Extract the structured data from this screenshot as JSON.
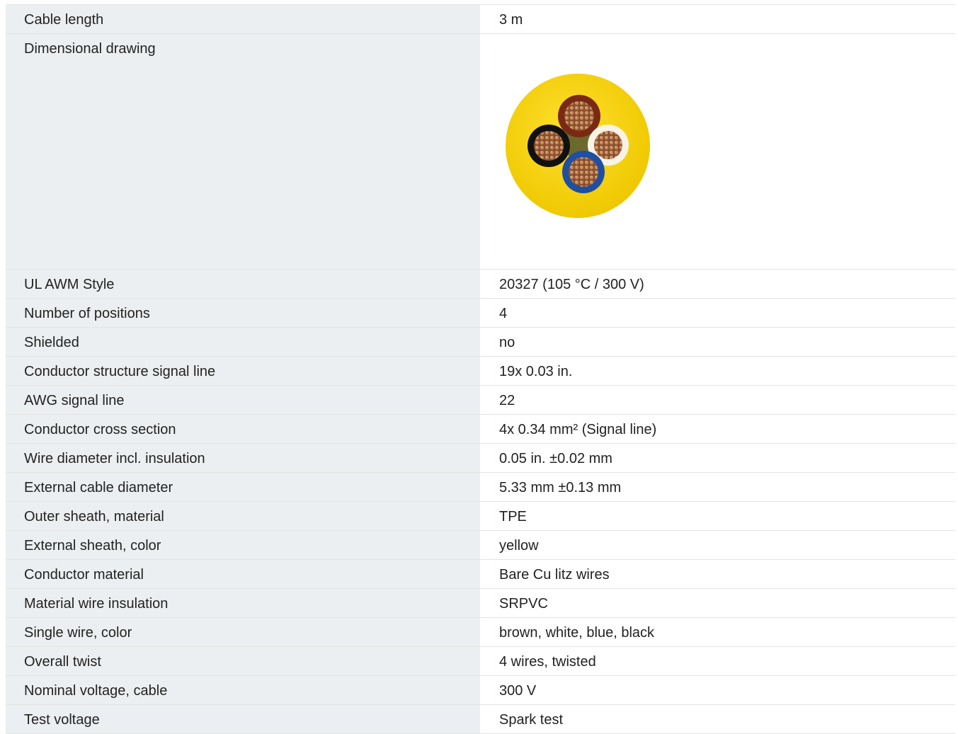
{
  "specs": [
    {
      "label": "Cable length",
      "value": "3 m"
    },
    {
      "label": "Dimensional drawing",
      "image": "cable-cross-section-drawing"
    },
    {
      "label": "UL AWM Style",
      "value": "20327 (105 °C / 300 V)"
    },
    {
      "label": "Number of positions",
      "value": "4"
    },
    {
      "label": "Shielded",
      "value": "no"
    },
    {
      "label": "Conductor structure signal line",
      "value": "19x 0.03 in."
    },
    {
      "label": "AWG signal line",
      "value": "22"
    },
    {
      "label": "Conductor cross section",
      "value": "4x 0.34 mm² (Signal line)"
    },
    {
      "label": "Wire diameter incl. insulation",
      "value": "0.05 in. ±0.02 mm"
    },
    {
      "label": "External cable diameter",
      "value": "5.33 mm ±0.13 mm"
    },
    {
      "label": "Outer sheath, material",
      "value": "TPE"
    },
    {
      "label": "External sheath, color",
      "value": "yellow"
    },
    {
      "label": "Conductor material",
      "value": "Bare Cu litz wires"
    },
    {
      "label": "Material wire insulation",
      "value": "SRPVC"
    },
    {
      "label": "Single wire, color",
      "value": "brown, white, blue, black"
    },
    {
      "label": "Overall twist",
      "value": "4 wires, twisted"
    },
    {
      "label": "Nominal voltage, cable",
      "value": "300 V"
    },
    {
      "label": "Test voltage",
      "value": "Spark test"
    }
  ],
  "colors": {
    "label_background": "#eceff1",
    "border": "#e3e3e3",
    "sheath_yellow": "#f5d10a",
    "wire_brown": "#7a2a14",
    "wire_white": "#f7f3e6",
    "wire_blue": "#1f4fa3",
    "wire_black": "#111111",
    "copper": "#b77a4a"
  }
}
